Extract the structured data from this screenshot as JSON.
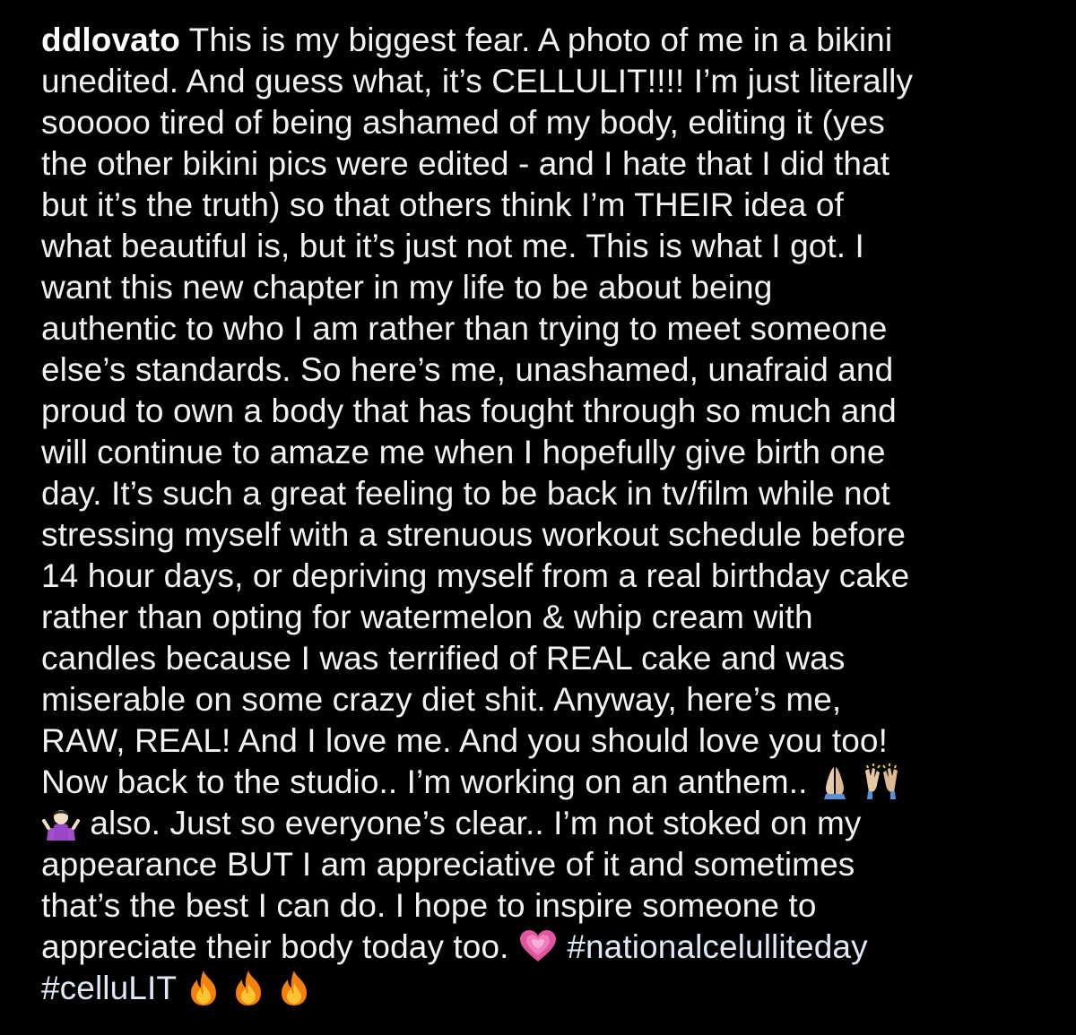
{
  "post": {
    "username": "ddlovato",
    "lines": [
      " This is my biggest fear. A photo of me in a bikini",
      "unedited. And guess what, it’s CELLULIT!!!! I’m just literally",
      "sooooo tired of being ashamed of my body, editing it (yes",
      "the other bikini pics were edited - and I hate that I did that",
      "but it’s the truth) so that others think I’m THEIR idea of",
      "what beautiful is, but it’s just not me. This is what I got. I",
      "want this new chapter in my life to be about being",
      "authentic to who I am rather than trying to meet someone",
      "else’s standards. So here’s me, unashamed, unafraid and",
      "proud to own a body that has fought through so much and",
      "will continue to amaze me when I hopefully give birth one",
      "day. It’s such a great feeling to be back in tv/film while not",
      "stressing myself with a strenuous workout schedule before",
      "14 hour days, or depriving myself from a real birthday cake",
      "rather than opting for watermelon & whip cream with",
      "candles because I was terrified of REAL cake and was",
      "miserable on some crazy diet shit. Anyway, here’s me,",
      "RAW, REAL! And I love me. And you should love you too!",
      "Now back to the studio.. I’m working on an anthem..",
      " also. Just so everyone’s clear.. I’m not stoked on my",
      "appearance BUT I am appreciative of it and sometimes",
      "that’s the best I can do. I hope to inspire someone to",
      "appreciate their body today too."
    ],
    "hashtags": [
      "#nationalcelulliteday",
      "#celluLIT"
    ],
    "emojis": {
      "line19": [
        "folded-hands-emoji",
        "raising-hands-emoji"
      ],
      "line20": [
        "person-shrugging-emoji"
      ],
      "line23": [
        "growing-heart-emoji"
      ],
      "line24": [
        "fire-emoji",
        "fire-emoji",
        "fire-emoji"
      ]
    }
  },
  "colors": {
    "background": "#000000",
    "text": "#f2f2f2",
    "hashtag": "#dfe8f5"
  }
}
